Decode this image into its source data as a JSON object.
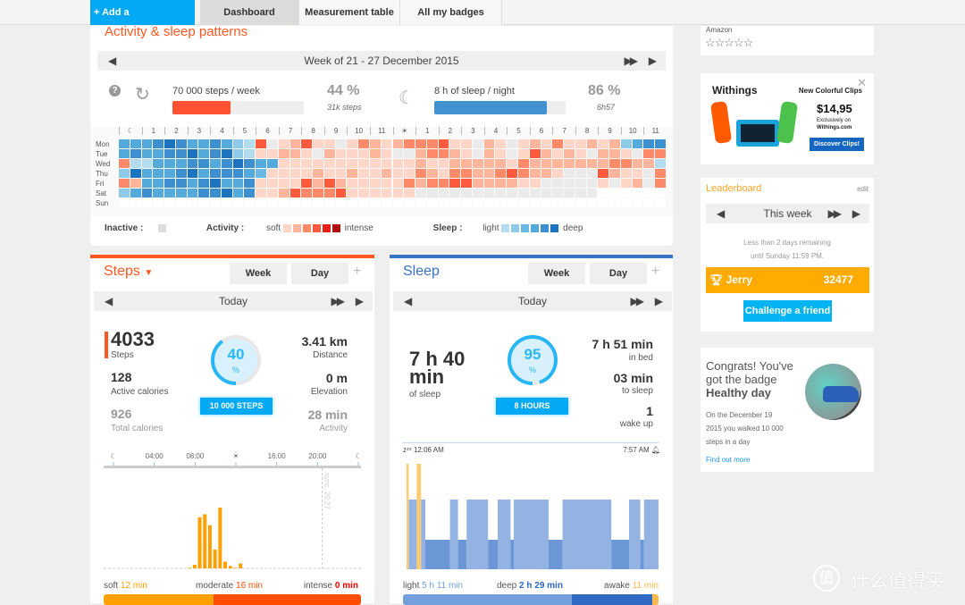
{
  "nav": {
    "add": "+ Add a measurement",
    "tabs": [
      "Dashboard",
      "Measurement table",
      "All my badges"
    ],
    "active": 0
  },
  "patterns": {
    "title": "Activity & sleep patterns",
    "week": "Week of 21 - 27 December 2015",
    "steps_goal": "70 000 steps / week",
    "steps_pct": "44 %",
    "steps_sub": "31k steps",
    "steps_fill": 0.44,
    "sleep_goal": "8 h of sleep / night",
    "sleep_pct": "86 %",
    "sleep_sub": "6h57",
    "sleep_fill": 0.86,
    "hours": [
      "☾",
      "1",
      "2",
      "3",
      "4",
      "5",
      "6",
      "7",
      "8",
      "9",
      "10",
      "11",
      "☀",
      "1",
      "2",
      "3",
      "4",
      "5",
      "6",
      "7",
      "8",
      "9",
      "10",
      "11"
    ],
    "days": [
      "Mon",
      "Tue",
      "Wed",
      "Thu",
      "Fri",
      "Sat",
      "Sun"
    ],
    "grid": [
      "444565445421diabdaaiacbabcccdaaibaiabacaabab2455",
      "454455645621aabbaibaaabaiibccbaibaiadbabaibbaicc",
      "c1144455456544aaaaaaaaaaaabaabbbbbacbbbbbbbccbb1",
      "2644456455543aaaabaabaabaacbaccbbcdcbbaiiidbaaic",
      "cb4455456445aaaadbdbaaaaacbccddbbbbaaiiiiiaiabic",
      "245444455645aabdcccdaaaaaaiiiiiiiiiiiiiiii.......",
      "................................................"
    ],
    "legend": {
      "inactive": "Inactive :",
      "activity": "Activity :",
      "soft": "soft",
      "intense": "intense",
      "sleep": "Sleep :",
      "light": "light",
      "deep": "deep"
    },
    "colors": {
      "sleep": [
        "#b3dcef",
        "#8fcbe9",
        "#6cb9e3",
        "#55aadc",
        "#3d8fd0",
        "#1c74c0"
      ],
      "activity": [
        "#ffd6c8",
        "#ffb49c",
        "#ff8a6a",
        "#ff5a3c",
        "#e62018",
        "#b01010"
      ],
      "inactive": "#ebebeb"
    }
  },
  "steps": {
    "title": "Steps",
    "week": "Week",
    "day": "Day",
    "today": "Today",
    "count": "4033",
    "count_label": "Steps",
    "active_cal": "128",
    "active_cal_label": "Active calories",
    "total_cal": "926",
    "total_cal_label": "Total calories",
    "pct": "40",
    "pct_unit": "%",
    "progress": 0.4,
    "goal": "10 000 STEPS",
    "distance": "3.41 km",
    "distance_label": "Distance",
    "elevation": "0 m",
    "elevation_label": "Elevation",
    "activity": "28 min",
    "activity_label": "Activity",
    "axis": [
      "☾",
      "04:00",
      "08:00",
      "☀",
      "16:00",
      "20:00",
      "☾"
    ],
    "sync": "sync. 20:27",
    "bars": [
      [
        7.5,
        1
      ],
      [
        8,
        6
      ],
      [
        8.5,
        84
      ],
      [
        9,
        89
      ],
      [
        9.5,
        71
      ],
      [
        10,
        31
      ],
      [
        10.5,
        100
      ],
      [
        11,
        11
      ],
      [
        11.5,
        4
      ],
      [
        12,
        1
      ],
      [
        12.5,
        8
      ]
    ],
    "soft_label": "soft",
    "soft": "12 min",
    "moderate_label": "moderate",
    "moderate": "16 min",
    "intense_label": "intense",
    "intense": "0 min"
  },
  "sleep": {
    "title": "Sleep",
    "week": "Week",
    "day": "Day",
    "today": "Today",
    "total": "7 h 40 min",
    "total_label": "of sleep",
    "pct": "95",
    "pct_unit": "%",
    "progress": 0.95,
    "goal": "8 HOURS",
    "in_bed": "7 h 51 min",
    "in_bed_label": "in bed",
    "to_sleep": "03 min",
    "to_sleep_label": "to sleep",
    "wakeups": "1",
    "wakeups_label": "wake up",
    "start": "12:06 AM",
    "end": "7:57 AM",
    "segments": [
      [
        "awake",
        4
      ],
      [
        "light",
        15
      ],
      [
        "awake",
        8
      ],
      [
        "light",
        8
      ],
      [
        "deep",
        46
      ],
      [
        "light",
        15
      ],
      [
        "deep",
        16
      ],
      [
        "light",
        40
      ],
      [
        "deep",
        18
      ],
      [
        "light",
        24
      ],
      [
        "deep",
        6
      ],
      [
        "light",
        65
      ],
      [
        "deep",
        26
      ],
      [
        "light",
        91
      ],
      [
        "deep",
        33
      ],
      [
        "light",
        21
      ],
      [
        "deep",
        7
      ],
      [
        "light",
        27
      ]
    ],
    "light_label": "light",
    "light": "5 h 11 min",
    "deep_label": "deep",
    "deep": "2 h 29 min",
    "awake_label": "awake",
    "awake": "11 min"
  },
  "side": {
    "amazon": "Amazon",
    "rating": 0,
    "ad": {
      "brand": "Withings",
      "headline": "New Colorful Clips",
      "price": "$14,95",
      "excl": "Exclusively on",
      "site": "Withings.com",
      "cta": "Discover Clips!"
    },
    "leader": {
      "title": "Leaderboard",
      "edit": "edit",
      "period": "This week",
      "remaining": "Less than 2 days remaining",
      "until": "until Sunday 11:59 PM.",
      "name": "Jerry",
      "score": "32477",
      "challenge": "Challenge a friend"
    },
    "badge": {
      "l1": "Congrats! You've",
      "l2": "got the badge",
      "name": "Healthy day",
      "d1": "On the December 19",
      "d2": "2015 you walked 10 000",
      "d3": "steps in a day",
      "more": "Find out more"
    }
  },
  "watermark": "什么值得买"
}
